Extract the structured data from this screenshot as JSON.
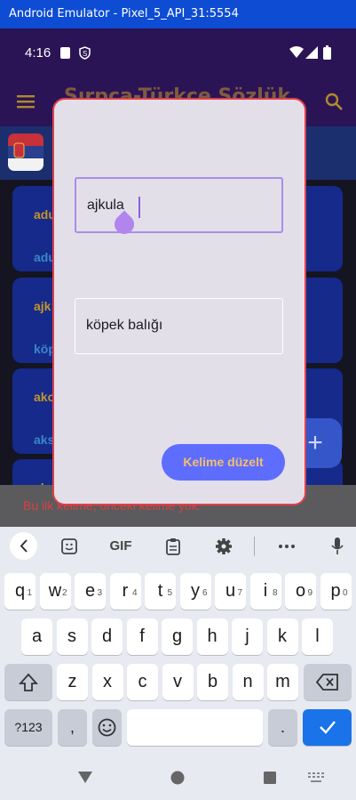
{
  "window": {
    "title": "Android Emulator - Pixel_5_API_31:5554"
  },
  "status_bar": {
    "time": "4:16"
  },
  "app_bar": {
    "title": "Sırpça-Türkçe Sözlük"
  },
  "list": {
    "cards": [
      {
        "word": "adu",
        "translation": "adu"
      },
      {
        "word": "ajk",
        "translation": "köp"
      },
      {
        "word": "ako",
        "translation": "aks"
      },
      {
        "word": "ako",
        "translation": ""
      }
    ]
  },
  "snackbar": {
    "text": "Bu ilk kelime, önceki kelime yok."
  },
  "dialog": {
    "serbian_value": "ajkula",
    "turkish_value": "köpek balığı",
    "save_label": "Kelime düzelt"
  },
  "keyboard": {
    "toolbar": {
      "gif_label": "GIF"
    },
    "row1": [
      {
        "k": "q",
        "h": "1"
      },
      {
        "k": "w",
        "h": "2"
      },
      {
        "k": "e",
        "h": "3"
      },
      {
        "k": "r",
        "h": "4"
      },
      {
        "k": "t",
        "h": "5"
      },
      {
        "k": "y",
        "h": "6"
      },
      {
        "k": "u",
        "h": "7"
      },
      {
        "k": "i",
        "h": "8"
      },
      {
        "k": "o",
        "h": "9"
      },
      {
        "k": "p",
        "h": "0"
      }
    ],
    "row2": [
      "a",
      "s",
      "d",
      "f",
      "g",
      "h",
      "j",
      "k",
      "l"
    ],
    "row3": [
      "z",
      "x",
      "c",
      "v",
      "b",
      "n",
      "m"
    ],
    "symbols_label": "?123",
    "comma_label": ",",
    "period_label": "."
  },
  "colors": {
    "accent_purple": "#a98ee8",
    "button_blue": "#5f6dff",
    "button_text": "#f3c06a",
    "dialog_border": "#e0404c",
    "enter_key": "#1a73e8"
  }
}
